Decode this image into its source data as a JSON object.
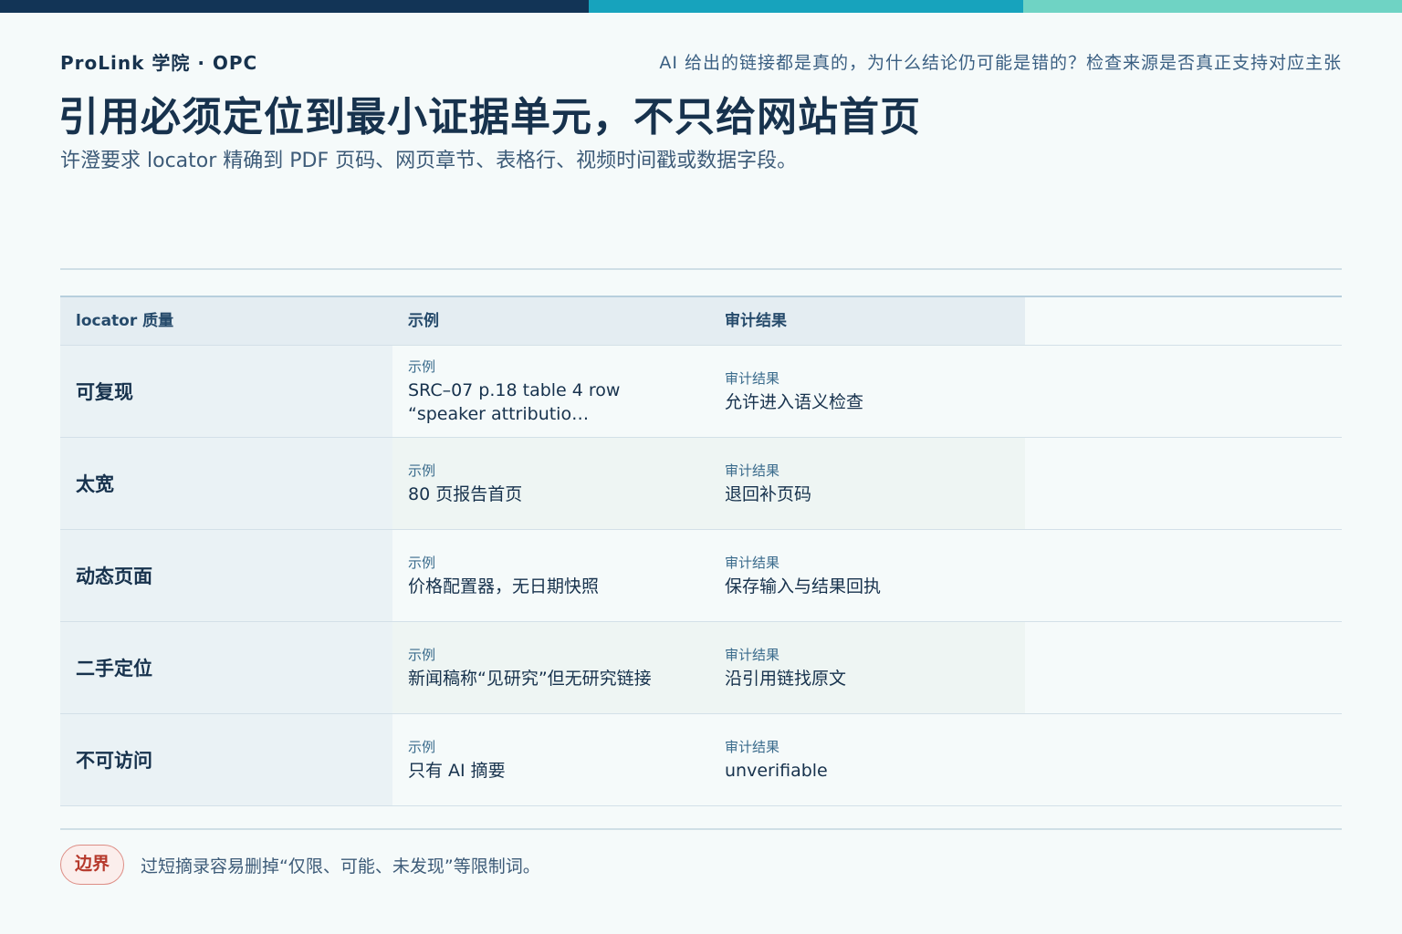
{
  "header": {
    "brand": "ProLink 学院 · OPC",
    "tagline": "AI 给出的链接都是真的，为什么结论仍可能是错的？检查来源是否真正支持对应主张",
    "title": "引用必须定位到最小证据单元，不只给网站首页",
    "subtitle": "许澄要求 locator 精确到 PDF 页码、网页章节、表格行、视频时间戳或数据字段。"
  },
  "table": {
    "columns": [
      "locator 质量",
      "示例",
      "审计结果"
    ],
    "example_label": "示例",
    "result_label": "审计结果",
    "rows": [
      {
        "quality": "可复现",
        "example": "SRC–07 p.18 table 4 row\n“speaker attributio…",
        "result": "允许进入语义检查"
      },
      {
        "quality": "太宽",
        "example": "80 页报告首页",
        "result": "退回补页码"
      },
      {
        "quality": "动态页面",
        "example": "价格配置器，无日期快照",
        "result": "保存输入与结果回执"
      },
      {
        "quality": "二手定位",
        "example": "新闻稿称“见研究”但无研究链接",
        "result": "沿引用链找原文"
      },
      {
        "quality": "不可访问",
        "example": "只有 AI 摘要",
        "result": "unverifiable"
      }
    ]
  },
  "footer": {
    "badge": "边界",
    "note": "过短摘录容易删掉“仅限、可能、未发现”等限制词。"
  },
  "colors": {
    "bar_navy": "#123456",
    "bar_teal": "#17a3bd",
    "bar_mint": "#6fd3c4",
    "badge_red": "#b6392c"
  }
}
